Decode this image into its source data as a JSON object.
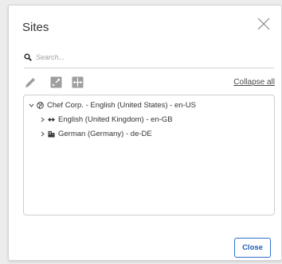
{
  "dialog": {
    "title": "Sites",
    "close_icon": "close-x-icon"
  },
  "search": {
    "placeholder": "Search...",
    "value": "",
    "icon": "search-icon"
  },
  "toolbar": {
    "tools": [
      {
        "name": "edit",
        "icon": "pencil-icon"
      },
      {
        "name": "expand",
        "icon": "expand-icon"
      },
      {
        "name": "move",
        "icon": "move-icon"
      }
    ],
    "collapse_all_label": "Collapse all"
  },
  "tree": {
    "root": {
      "label": "Chef Corp. - English (United States) - en-US",
      "icon": "globe-icon",
      "expanded": true
    },
    "children": [
      {
        "label": "English (United Kingdom) - en-GB",
        "icon": "arrows-horizontal-icon",
        "expanded": false
      },
      {
        "label": "German (Germany) - de-DE",
        "icon": "building-icon",
        "expanded": false
      }
    ]
  },
  "footer": {
    "close_label": "Close"
  },
  "colors": {
    "accent": "#2f6fc8",
    "text": "#333333",
    "icon_disabled": "#9e9e9e",
    "border": "#cfcfcf"
  }
}
